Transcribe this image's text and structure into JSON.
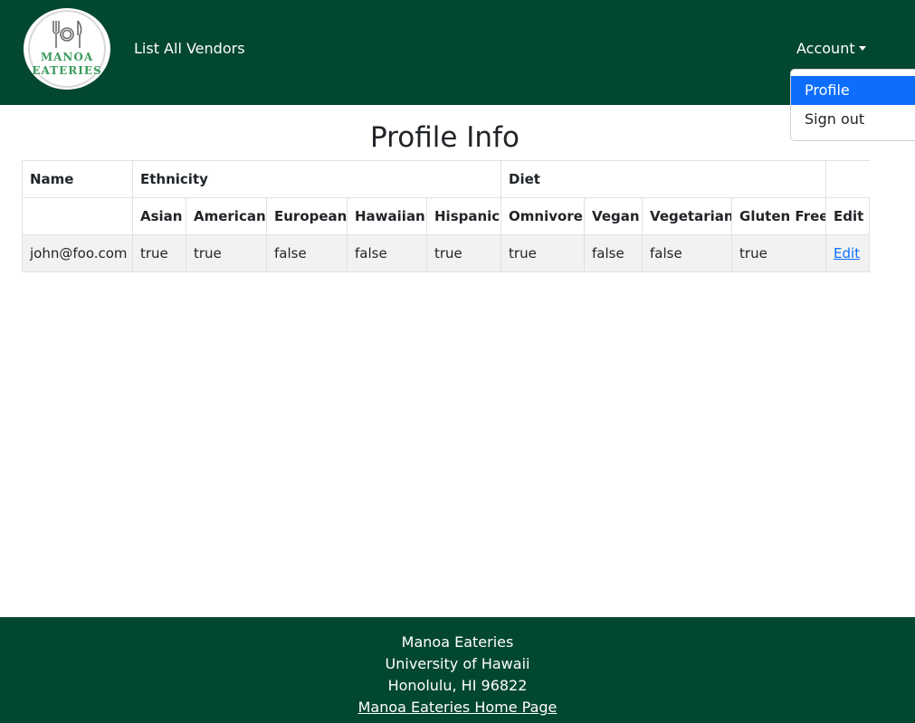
{
  "navbar": {
    "logo": {
      "line1": "MANOA",
      "line2": "EATERIES"
    },
    "list_vendors_label": "List All Vendors",
    "account_label": "Account",
    "colors": {
      "navbar_bg": "#024731",
      "logo_text": "#3a9a5c"
    }
  },
  "account_menu": {
    "items": [
      {
        "label": "Profile",
        "active": true
      },
      {
        "label": "Sign out",
        "active": false
      }
    ],
    "active_color": "#0d6efd"
  },
  "main": {
    "title": "Profile Info",
    "table": {
      "group_headers": [
        "Name",
        "Ethnicity",
        "Diet"
      ],
      "columns": [
        "Asian",
        "American",
        "European",
        "Hawaiian",
        "Hispanic",
        "Omnivore",
        "Vegan",
        "Vegetarian",
        "Gluten Free",
        "Edit"
      ],
      "row": {
        "name": "john@foo.com",
        "values": [
          "true",
          "true",
          "false",
          "false",
          "true",
          "true",
          "false",
          "false",
          "true"
        ],
        "edit_label": "Edit"
      }
    }
  },
  "footer": {
    "line1": "Manoa Eateries",
    "line2": "University of Hawaii",
    "line3": "Honolulu, HI 96822",
    "home_link": "Manoa Eateries Home Page"
  }
}
